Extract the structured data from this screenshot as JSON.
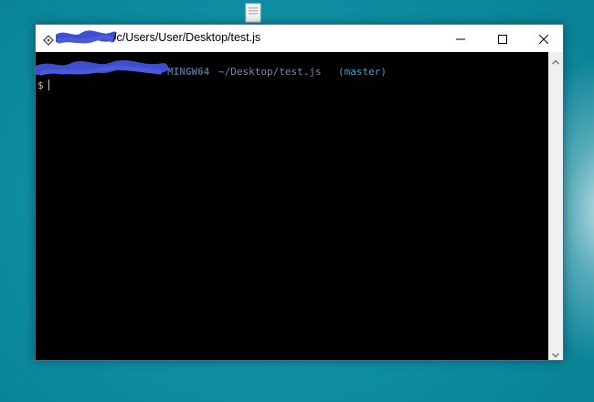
{
  "window": {
    "title": "/c/Users/User/Desktop/test.js",
    "controls": [
      "minimize-icon",
      "maximize-icon",
      "close-icon"
    ]
  },
  "terminal": {
    "prompt": {
      "system": "MINGW64",
      "cwd": "~/Desktop/test.js",
      "branch": "(master)",
      "symbol": "$"
    }
  },
  "colors": {
    "system": "#4a6c94",
    "cwd": "#6d8eb2",
    "branch": "#35a6c8",
    "redaction": "#3d4fd0",
    "desktop": "#0f8ea2"
  },
  "icons": {
    "desktop_file": "file-icon",
    "app": "git-bash-icon",
    "scroll_up": "chevron-up-icon",
    "scroll_down": "chevron-down-icon"
  }
}
